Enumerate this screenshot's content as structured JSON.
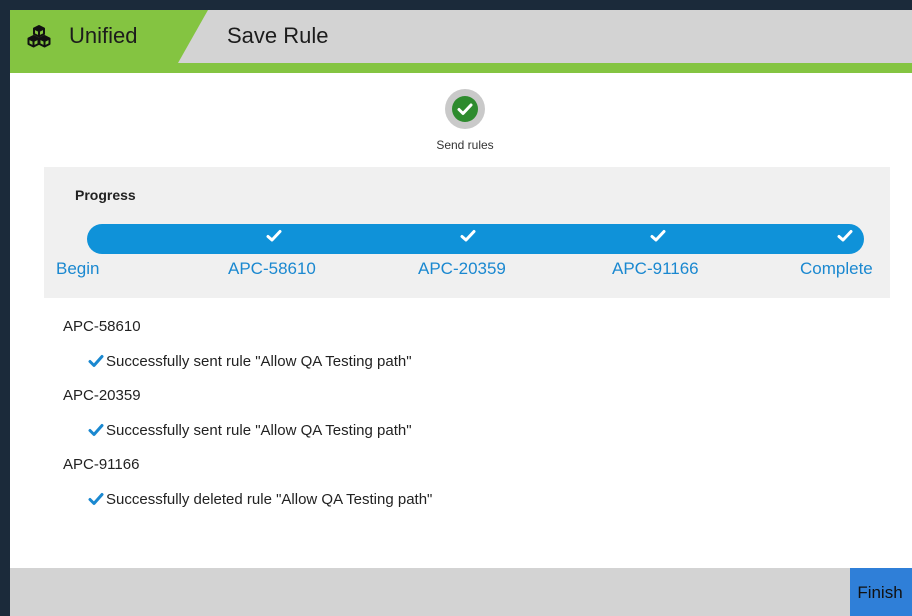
{
  "header": {
    "brand_label": "Unified",
    "brand_icon": "cubes-icon",
    "title": "Save Rule",
    "brand_color": "#84c441"
  },
  "step": {
    "icon": "check-circle-icon",
    "label": "Send rules",
    "status_color": "#2e8b2e"
  },
  "progress": {
    "title": "Progress",
    "bar_color": "#0f92d9",
    "stages": [
      {
        "label": "Begin",
        "done": false
      },
      {
        "label": "APC-58610",
        "done": true
      },
      {
        "label": "APC-20359",
        "done": true
      },
      {
        "label": "APC-91166",
        "done": true
      },
      {
        "label": "Complete",
        "done": true
      }
    ]
  },
  "results": [
    {
      "device": "APC-58610",
      "message": "Successfully sent rule \"Allow QA Testing path\""
    },
    {
      "device": "APC-20359",
      "message": "Successfully sent rule \"Allow QA Testing path\""
    },
    {
      "device": "APC-91166",
      "message": "Successfully deleted rule \"Allow QA Testing path\""
    }
  ],
  "footer": {
    "finish_label": "Finish",
    "finish_color": "#2f7fd8"
  }
}
